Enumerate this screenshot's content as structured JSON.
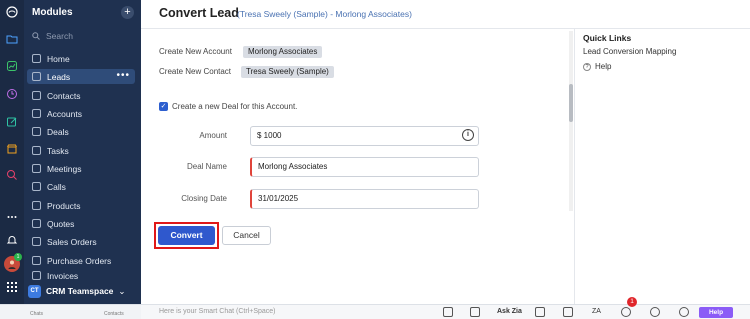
{
  "sidebar": {
    "heading": "Modules",
    "plus": "+",
    "search_placeholder": "Search",
    "items": [
      {
        "label": "Home",
        "icon": "home-icon"
      },
      {
        "label": "Leads",
        "icon": "leads-icon",
        "active": true
      },
      {
        "label": "Contacts",
        "icon": "contacts-icon"
      },
      {
        "label": "Accounts",
        "icon": "accounts-icon"
      },
      {
        "label": "Deals",
        "icon": "deals-icon"
      },
      {
        "label": "Tasks",
        "icon": "tasks-icon"
      },
      {
        "label": "Meetings",
        "icon": "meetings-icon"
      },
      {
        "label": "Calls",
        "icon": "calls-icon"
      },
      {
        "label": "Products",
        "icon": "products-icon"
      },
      {
        "label": "Quotes",
        "icon": "quotes-icon"
      },
      {
        "label": "Sales Orders",
        "icon": "sales-orders-icon"
      },
      {
        "label": "Purchase Orders",
        "icon": "purchase-orders-icon"
      },
      {
        "label": "Invoices",
        "icon": "invoices-icon"
      }
    ],
    "more": "•••",
    "team": {
      "badge": "CT",
      "label": "CRM Teamspace",
      "chevron": "⌄"
    }
  },
  "header": {
    "title": "Convert Lead",
    "subtitle": "(Tresa Sweely (Sample) - Morlong Associates)"
  },
  "form": {
    "create_account_label": "Create New Account",
    "create_account_value": "Morlong Associates",
    "create_contact_label": "Create New Contact",
    "create_contact_value": "Tresa Sweely (Sample)",
    "deal_checkbox_label": "Create a new Deal for this Account.",
    "deal_checkbox_checked": true,
    "amount_label": "Amount",
    "amount_value": "$ 1000",
    "deal_name_label": "Deal Name",
    "deal_name_value": "Morlong Associates",
    "closing_date_label": "Closing Date",
    "closing_date_value": "31/01/2025",
    "convert_label": "Convert",
    "cancel_label": "Cancel"
  },
  "quick_links": {
    "title": "Quick Links",
    "items": [
      "Lead Conversion Mapping",
      "Help"
    ]
  },
  "bottom_bar": {
    "left_labels": [
      "Chats",
      "Contacts"
    ],
    "chat_placeholder": "Here is your Smart Chat (Ctrl+Space)",
    "ask_zia": "Ask Zia",
    "zia_short": "ZA",
    "notification_count": "1",
    "help_label": "Help"
  },
  "rail_badge": "1",
  "colors": {
    "sidebar_bg": "#1f3150",
    "rail_bg": "#1b2a44",
    "accent": "#2f58cd",
    "highlight_border": "#e01818",
    "required": "#e0443b"
  }
}
